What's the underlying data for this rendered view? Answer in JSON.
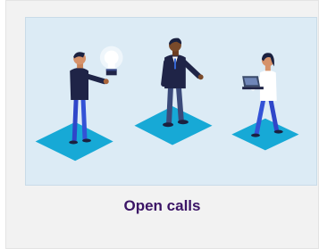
{
  "card": {
    "title": "Open calls",
    "title_color": "#3b1466",
    "illustration_background": "#dcebf5",
    "platform_color": "#17a9d6",
    "icons": [
      "lightbulb-icon",
      "laptop-icon"
    ]
  }
}
